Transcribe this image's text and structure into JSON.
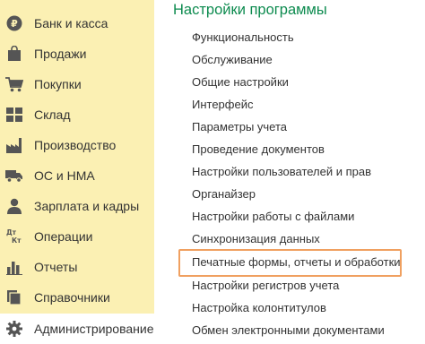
{
  "sidebar": {
    "items": [
      {
        "label": "Банк и касса",
        "icon": "bank-coin-icon"
      },
      {
        "label": "Продажи",
        "icon": "shopping-bag-icon"
      },
      {
        "label": "Покупки",
        "icon": "cart-icon"
      },
      {
        "label": "Склад",
        "icon": "warehouse-grid-icon"
      },
      {
        "label": "Производство",
        "icon": "factory-icon"
      },
      {
        "label": "ОС и НМА",
        "icon": "truck-icon"
      },
      {
        "label": "Зарплата и кадры",
        "icon": "person-icon"
      },
      {
        "label": "Операции",
        "icon": "dt-kt-icon",
        "icon_text": "Дт Кт"
      },
      {
        "label": "Отчеты",
        "icon": "bar-chart-icon"
      },
      {
        "label": "Справочники",
        "icon": "books-icon"
      },
      {
        "label": "Администрирование",
        "icon": "gear-icon",
        "active": true
      }
    ]
  },
  "panel": {
    "title": "Настройки программы",
    "links": [
      "Функциональность",
      "Обслуживание",
      "Общие настройки",
      "Интерфейс",
      "Параметры учета",
      "Проведение документов",
      "Настройки пользователей и прав",
      "Органайзер",
      "Настройки работы с файлами",
      "Синхронизация данных",
      "Печатные формы, отчеты и обработки",
      "Настройки регистров учета",
      "Настройка колонтитулов",
      "Обмен электронными документами"
    ],
    "highlighted_link": "Печатные формы, отчеты и обработки"
  },
  "colors": {
    "sidebar_bg": "#fbf0b3",
    "title_green": "#0d8b4f",
    "icon_dark": "#555555",
    "highlight_border": "#f0a060"
  }
}
